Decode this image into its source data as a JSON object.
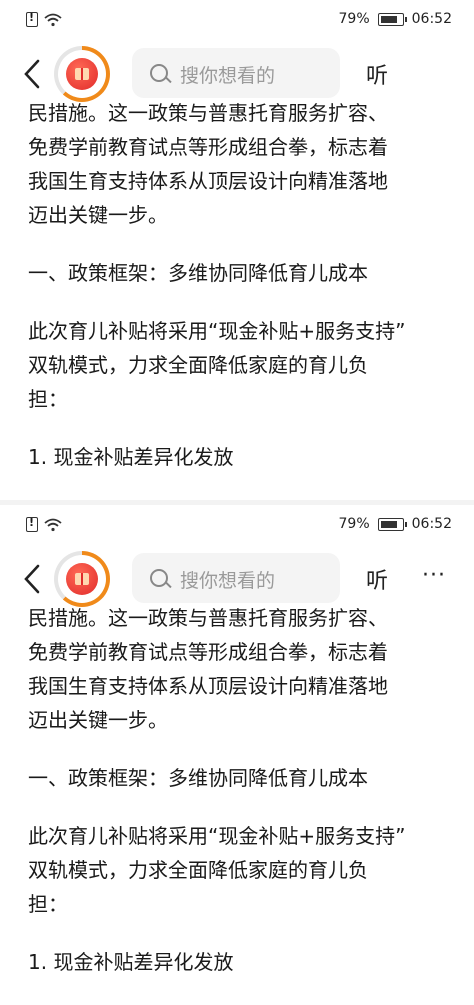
{
  "status": {
    "battery_text": "79%",
    "time": "06:52"
  },
  "nav": {
    "search_placeholder": "搜你想看的",
    "listen_label": "听",
    "more_label": "···"
  },
  "article": {
    "p1": [
      "民措施。这一政策与普惠托育服务扩容、",
      "免费学前教育试点等形成组合拳，标志着",
      "我国生育支持体系从顶层设计向精准落地",
      "迈出关键一步。"
    ],
    "p2": [
      "一、政策框架：多维协同降低育儿成本"
    ],
    "p3": [
      "此次育儿补贴将采用“现金补贴+服务支持”",
      "双轨模式，力求全面降低家庭的育儿负",
      "担："
    ],
    "p4": [
      "1. 现金补贴差异化发放"
    ]
  },
  "colors": {
    "accent": "#f08a1a",
    "gift_red": "#e12b2b"
  }
}
